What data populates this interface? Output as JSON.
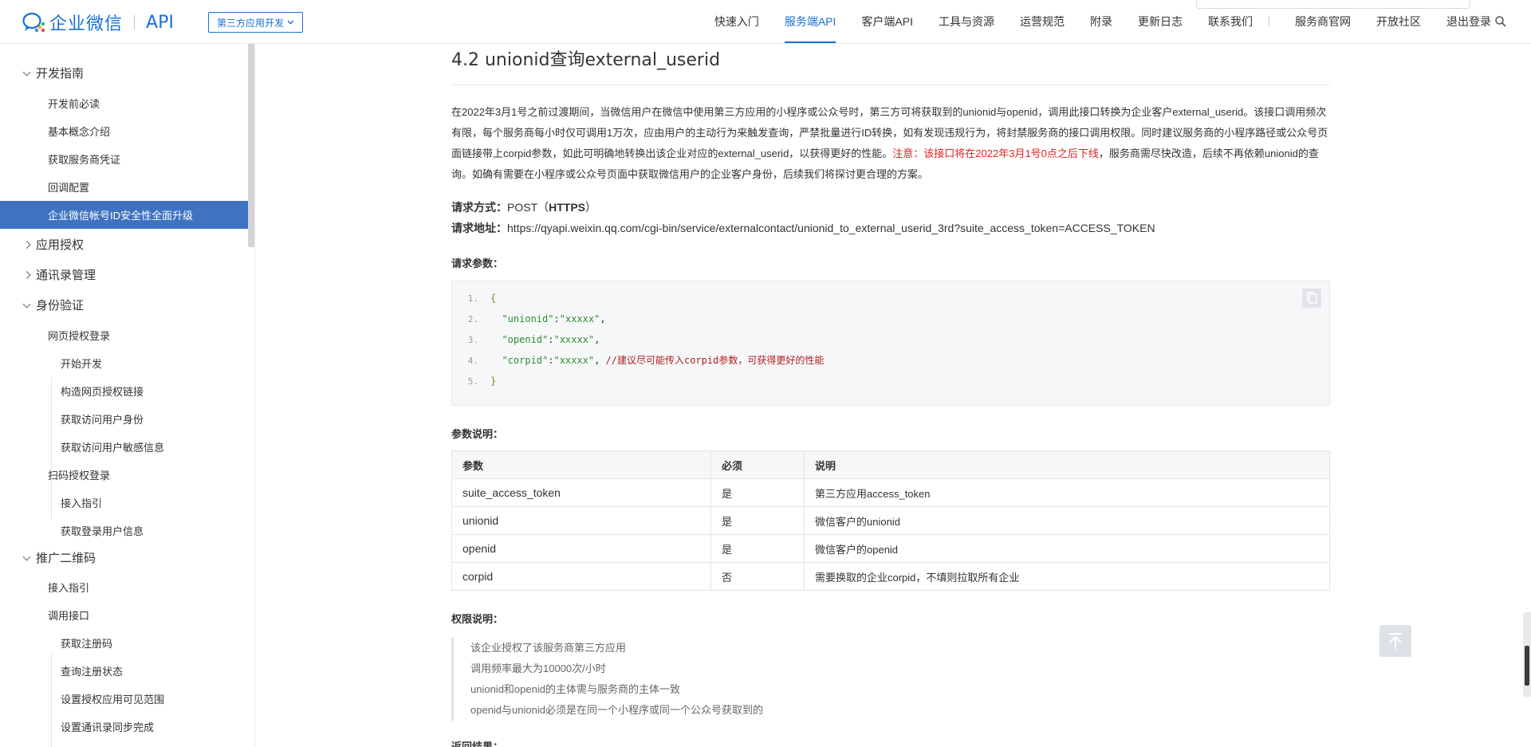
{
  "header": {
    "logo_text": "企业微信",
    "logo_api": "API",
    "app_select": "第三方应用开发",
    "nav": [
      {
        "label": "快速入门",
        "active": false
      },
      {
        "label": "服务端API",
        "active": true
      },
      {
        "label": "客户端API",
        "active": false
      },
      {
        "label": "工具与资源",
        "active": false
      },
      {
        "label": "运营规范",
        "active": false
      },
      {
        "label": "附录",
        "active": false
      },
      {
        "label": "更新日志",
        "active": false
      },
      {
        "label": "联系我们",
        "active": false
      },
      {
        "label": "服务商官网",
        "active": false
      },
      {
        "label": "开放社区",
        "active": false
      },
      {
        "label": "退出登录",
        "active": false
      }
    ]
  },
  "sidebar": {
    "items": [
      {
        "label": "开发指南",
        "level": 0,
        "arrow": "down"
      },
      {
        "label": "开发前必读",
        "level": 1
      },
      {
        "label": "基本概念介绍",
        "level": 1
      },
      {
        "label": "获取服务商凭证",
        "level": 1
      },
      {
        "label": "回调配置",
        "level": 1
      },
      {
        "label": "企业微信帐号ID安全性全面升级",
        "level": 1,
        "active": true
      },
      {
        "label": "应用授权",
        "level": 0,
        "arrow": "right"
      },
      {
        "label": "通讯录管理",
        "level": 0,
        "arrow": "right"
      },
      {
        "label": "身份验证",
        "level": 0,
        "arrow": "down"
      },
      {
        "label": "网页授权登录",
        "level": 1
      },
      {
        "label": "开始开发",
        "level": 2
      },
      {
        "label": "构造网页授权链接",
        "level": 2
      },
      {
        "label": "获取访问用户身份",
        "level": 2
      },
      {
        "label": "获取访问用户敏感信息",
        "level": 2
      },
      {
        "label": "扫码授权登录",
        "level": 1
      },
      {
        "label": "接入指引",
        "level": 2
      },
      {
        "label": "获取登录用户信息",
        "level": 2
      },
      {
        "label": "推广二维码",
        "level": 0,
        "arrow": "down"
      },
      {
        "label": "接入指引",
        "level": 1
      },
      {
        "label": "调用接口",
        "level": 1
      },
      {
        "label": "获取注册码",
        "level": 2
      },
      {
        "label": "查询注册状态",
        "level": 2
      },
      {
        "label": "设置授权应用可见范围",
        "level": 2
      },
      {
        "label": "设置通讯录同步完成",
        "level": 2
      }
    ]
  },
  "main": {
    "title": "4.2 unionid查询external_userid",
    "intro_text": "在2022年3月1号之前过渡期间，当微信用户在微信中使用第三方应用的小程序或公众号时，第三方可将获取到的unionid与openid，调用此接口转换为企业客户external_userid。该接口调用频次有限，每个服务商每小时仅可调用1万次，应由用户的主动行为来触发查询，严禁批量进行ID转换，如有发现违规行为，将封禁服务商的接口调用权限。同时建议服务商的小程序路径或公众号页面链接带上corpid参数，如此可明确地转换出该企业对应的external_userid，以获得更好的性能。",
    "intro_warning": "注意：该接口将在2022年3月1号0点之后下线",
    "intro_tail": "，服务商需尽快改造，后续不再依赖unionid的查询。如确有需要在小程序或公众号页面中获取微信用户的企业客户身份，后续我们将探讨更合理的方案。",
    "method_label": "请求方式：",
    "method_value": "POST（",
    "method_https": "HTTPS",
    "method_close": "）",
    "url_label": "请求地址：",
    "url_value": "https://qyapi.weixin.qq.com/cgi-bin/service/externalcontact/unionid_to_external_userid_3rd?suite_access_token=ACCESS_TOKEN",
    "params_heading": "请求参数：",
    "code": {
      "line_numbers": [
        "1.",
        "2.",
        "3.",
        "4.",
        "5."
      ],
      "open_brace": "{",
      "close_brace": "}",
      "l2_key": "\"unionid\"",
      "l2_val": "\"xxxxx\"",
      "l3_key": "\"openid\"",
      "l3_val": "\"xxxxx\"",
      "l4_key": "\"corpid\"",
      "l4_val": "\"xxxxx\"",
      "l4_comment": "//建议尽可能传入corpid参数，可获得更好的性能",
      "colon": ":",
      "comma": ","
    },
    "desc_heading": "参数说明：",
    "table": {
      "headers": [
        "参数",
        "必须",
        "说明"
      ],
      "rows": [
        [
          "suite_access_token",
          "是",
          "第三方应用access_token"
        ],
        [
          "unionid",
          "是",
          "微信客户的unionid"
        ],
        [
          "openid",
          "是",
          "微信客户的openid"
        ],
        [
          "corpid",
          "否",
          "需要换取的企业corpid，不填则拉取所有企业"
        ]
      ]
    },
    "perm_heading": "权限说明：",
    "perm_lines": [
      "该企业授权了该服务商第三方应用",
      "调用频率最大为10000次/小时",
      "unionid和openid的主体需与服务商的主体一致",
      "openid与unionid必须是在同一个小程序或同一个公众号获取到的"
    ],
    "return_heading": "返回结果："
  },
  "colors": {
    "brand_blue": "#1a6fd1",
    "active_menu_bg": "#3f73c1",
    "warning_red": "#e02020"
  }
}
